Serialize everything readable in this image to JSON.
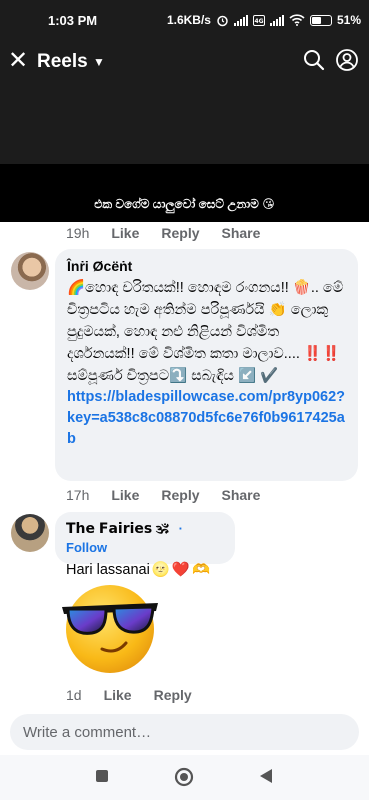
{
  "status_bar": {
    "time": "1:03 PM",
    "network_speed": "1.6KB/s",
    "battery": "51",
    "icons": [
      "alarm-icon",
      "signal-icon",
      "volte-icon",
      "wifi-icon",
      "battery-icon"
    ]
  },
  "header": {
    "title": "Reels",
    "icons": [
      "close-icon",
      "chevron-down-icon",
      "search-icon",
      "profile-icon"
    ]
  },
  "video": {
    "caption": "එක වගේම යාලුවෝ සෙට් උනාම 😘"
  },
  "meta_top": {
    "time": "19h",
    "like": "Like",
    "reply": "Reply",
    "share": "Share"
  },
  "comment1": {
    "author": "Înṙi Øcëṅt",
    "text": "🌈හොඳ චරිතයක්!! හොඳම රංගනය!! 🍿.. මේ චිත්‍රපටිය හැම අතින්ම පරිපූර්ණයි 👏 ලොකු පුදුමයක්, හොඳ නළු නිළියන් විශ්මිත දර්ශනයක්!! මේ විශ්මිත කතා මාලාව.... ‼️‼️ සම්පූර්ණ චිත්‍රපට⤵️ සබැඳිය ↙️ ✔️",
    "link": "https://bladespillowcase.com/pr8yp062?key=a538c8c08870d5fc6e76f0b9617425ab",
    "time": "17h",
    "like": "Like",
    "reply": "Reply",
    "share": "Share"
  },
  "comment2": {
    "author": "𝗧𝗵𝗲 𝗙𝗮𝗶𝗿𝗶𝗲𝘀 🕉",
    "follow": "Follow",
    "text": "Hari lassanai",
    "emojis": [
      "🌝",
      "❤️",
      "🫶"
    ],
    "sticker": "cool-emoji-sticker",
    "time": "1d",
    "like": "Like",
    "reply": "Reply"
  },
  "composer": {
    "placeholder": "Write a comment…"
  },
  "nav": {
    "icons": [
      "recents-icon",
      "home-icon",
      "back-icon"
    ]
  }
}
